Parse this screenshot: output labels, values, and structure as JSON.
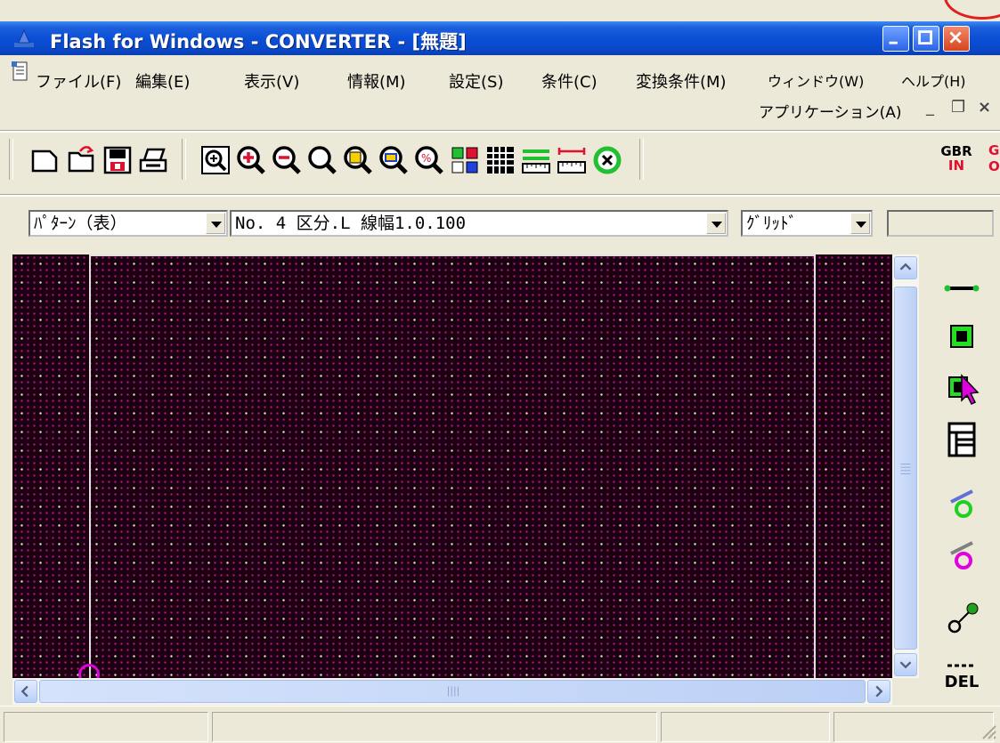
{
  "window": {
    "title": "Flash for Windows - CONVERTER - [無題]"
  },
  "menu": {
    "items": [
      "ファイル(F)",
      "編集(E)",
      "表示(V)",
      "情報(M)",
      "設定(S)",
      "条件(C)",
      "変換条件(M)",
      "ウィンドウ(W)",
      "ヘルプ(H)"
    ],
    "second_row": "アプリケーション(A)"
  },
  "toolbar": {
    "buttons": [
      "new-file-icon",
      "open-file-icon",
      "save-icon",
      "print-icon",
      "zoom-fit-icon",
      "zoom-in-icon",
      "zoom-out-icon",
      "zoom-area-icon",
      "zoom-window-icon",
      "zoom-percent-icon",
      "layer-colors-icon",
      "grid-icon",
      "measure-icon",
      "measure-distance-icon",
      "close-circle-icon",
      "gbr-in-icon"
    ],
    "gbr_label_top": "GBR",
    "gbr_label_bottom": "IN"
  },
  "combos": {
    "pattern": "ﾊﾟﾀｰﾝ（表）",
    "layer": "No.  4 区分.L 線幅1.0.100",
    "grid": "ｸﾞﾘｯﾄﾞ"
  },
  "right_tools": {
    "buttons": [
      "line-tool-icon",
      "rectangle-tool-icon",
      "select-tool-icon",
      "page-tool-icon",
      "green-circle-tool-icon",
      "magenta-circle-tool-icon",
      "node-tool-icon",
      "delete-tool-icon"
    ],
    "del_label": "DEL"
  },
  "status": {
    "panels": [
      "",
      "",
      "",
      ""
    ]
  }
}
